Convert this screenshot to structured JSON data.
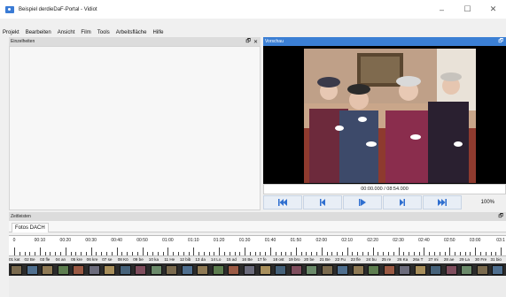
{
  "window": {
    "title": "Beispiel derdieDaF-Portal - Vidiot",
    "minimize": "–",
    "maximize": "☐",
    "close": "✕"
  },
  "menu": [
    "Projekt",
    "Bearbeiten",
    "Ansicht",
    "Film",
    "Tools",
    "Arbeitsfläche",
    "Hilfe"
  ],
  "panels": {
    "einzelheiten": {
      "title": "Einzelheiten",
      "float": "🗗",
      "close": "✕"
    },
    "vorschau": {
      "title": "Vorschau",
      "float": "🗗"
    },
    "zeitleisten": {
      "title": "Zeitleisten",
      "float": "🗗"
    }
  },
  "preview": {
    "timecode": "00:00.000 / 08:54.000",
    "zoom": "100%"
  },
  "timeline": {
    "tab": "Fotos DACH",
    "ruler": [
      "0",
      "00:10",
      "00:20",
      "00:30",
      "00:40",
      "00:50",
      "01:00",
      "01:10",
      "01:20",
      "01:30",
      "01:40",
      "01:50",
      "02:00",
      "02:10",
      "02:20",
      "02:30",
      "02:40",
      "02:50",
      "03:00",
      "03:1"
    ],
    "clips": [
      "01 kat",
      "02 Be",
      "03 fle",
      "04 an",
      "05 kre",
      "06 kre",
      "07 se",
      "08 Kö",
      "09 be",
      "10 ka",
      "11 He",
      "12 bib",
      "13 da",
      "14 Lo",
      "15 ad",
      "16 Be",
      "17 fe",
      "18 ost",
      "19 bro",
      "20 be",
      "21 Be",
      "22 Fu",
      "23 fle",
      "24 bu",
      "25 re",
      "26 Ka",
      "26a T",
      "27 mi",
      "28 ae",
      "29 La",
      "30 Fre",
      "31 bio"
    ]
  },
  "colors": {
    "accent": "#3b7fd4",
    "transport_icon": "#2f6fd0"
  }
}
